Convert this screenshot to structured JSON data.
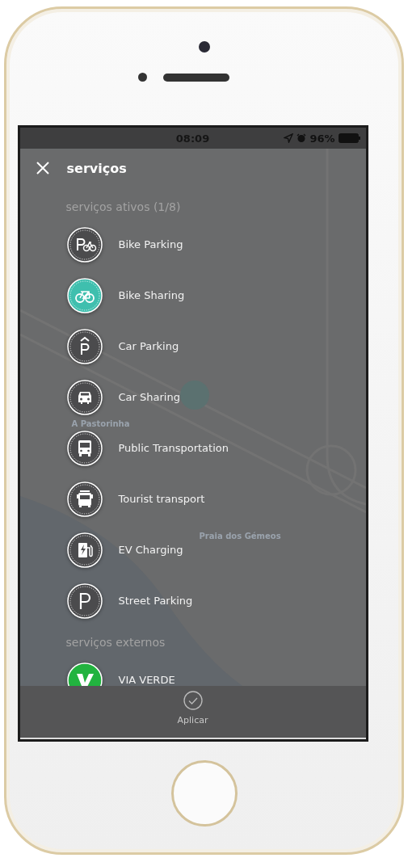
{
  "status_bar": {
    "time": "08:09",
    "battery": "96%"
  },
  "header": {
    "title": "serviços"
  },
  "map_labels": [
    {
      "text": "A Pastorinha"
    },
    {
      "text": "Praia dos Gémeos"
    }
  ],
  "sections": [
    {
      "title": "serviços ativos (1/8)",
      "items": [
        {
          "label": "Bike Parking",
          "kind": "bike-parking",
          "selected": false
        },
        {
          "label": "Bike Sharing",
          "kind": "bike-sharing",
          "selected": true
        },
        {
          "label": "Car Parking",
          "kind": "car-parking",
          "selected": false
        },
        {
          "label": "Car Sharing",
          "kind": "car-sharing",
          "selected": false
        },
        {
          "label": "Public Transportation",
          "kind": "bus",
          "selected": false
        },
        {
          "label": "Tourist transport",
          "kind": "tourist",
          "selected": false
        },
        {
          "label": "EV Charging",
          "kind": "ev",
          "selected": false
        },
        {
          "label": "Street Parking",
          "kind": "street-parking",
          "selected": false
        }
      ]
    },
    {
      "title": "serviços externos",
      "items": [
        {
          "label": "VIA VERDE",
          "kind": "via-verde"
        }
      ]
    }
  ],
  "apply_button": {
    "label": "Aplicar"
  }
}
